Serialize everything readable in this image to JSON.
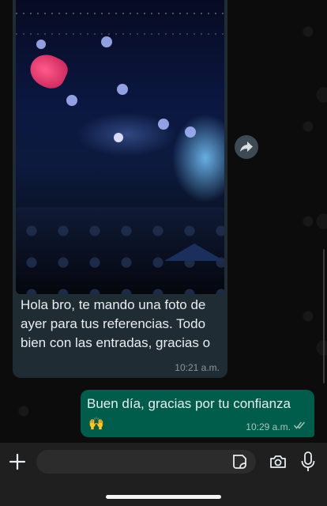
{
  "chat": {
    "incoming": {
      "text": "Hola bro, te mando una foto de ayer para tus referencias. Todo bien con las entradas, gracias o",
      "time": "10:21 a.m."
    },
    "outgoing": {
      "text": "Buen día, gracias por tu confianza",
      "emoji": "🙌",
      "time": "10:29 a.m.",
      "status": "read"
    }
  },
  "composer": {
    "placeholder": ""
  },
  "colors": {
    "incoming_bubble": "#202c33",
    "outgoing_bubble": "#005c4b",
    "timestamp": "#8696a0"
  },
  "icons": [
    "forward-icon",
    "plus-icon",
    "sticker-icon",
    "camera-icon",
    "mic-icon",
    "double-check-icon"
  ]
}
